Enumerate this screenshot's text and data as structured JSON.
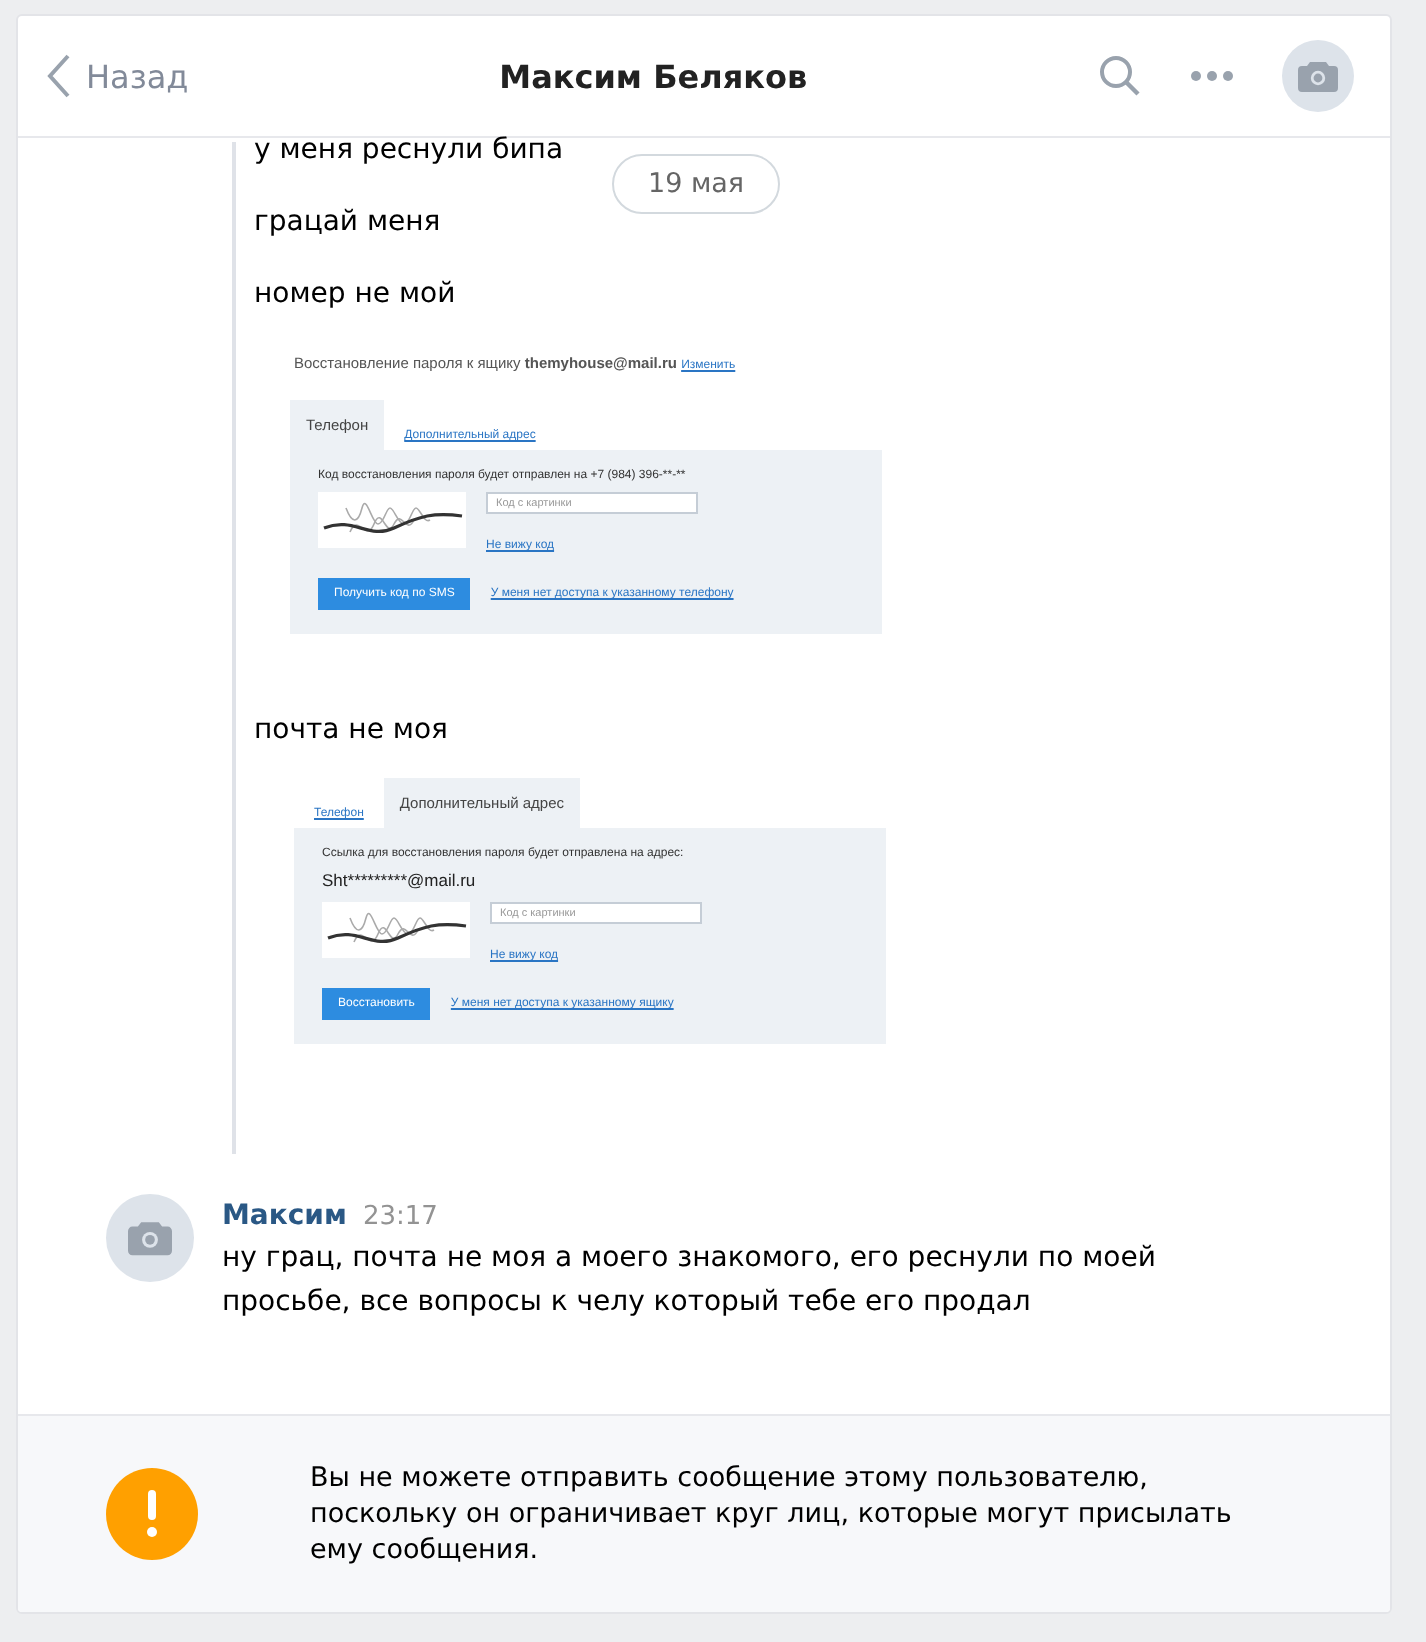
{
  "header": {
    "back_label": "Назад",
    "title": "Максим Беляков"
  },
  "date_pill": "19 мая",
  "forwarded": [
    {
      "kind": "text",
      "text": "у меня реснули бипа"
    },
    {
      "kind": "text",
      "text": "грацай меня"
    },
    {
      "kind": "text",
      "text": "номер не мой"
    },
    {
      "kind": "screenshot",
      "title": "Восстановление пароля к ящику **themyhouse@mail.ru**",
      "title_link": "Изменить",
      "tabs": [
        {
          "label": "Телефон",
          "selected": true
        },
        {
          "label": "Дополнительный адрес",
          "selected": false
        }
      ],
      "hint": "Код восстановления пароля будет отправлен на +7 (984) 396-**-**",
      "captcha_placeholder": "Код с картинки",
      "cant_see": "Не вижу код",
      "button": "Получить код по SMS",
      "no_access": "У меня нет доступа к указанному телефону"
    },
    {
      "kind": "text",
      "text": "почта не моя"
    },
    {
      "kind": "screenshot",
      "tabs": [
        {
          "label": "Телефон",
          "selected": false
        },
        {
          "label": "Дополнительный адрес",
          "selected": true
        }
      ],
      "hint": "Ссылка для восстановления пароля будет отправлена на адрес:",
      "address": "Sht*********@mail.ru",
      "captcha_placeholder": "Код с картинки",
      "cant_see": "Не вижу код",
      "button": "Восстановить",
      "no_access": "У меня нет доступа к указанному ящику"
    }
  ],
  "message": {
    "author": "Максим",
    "time": "23:17",
    "text": "ну грац, почта не моя а моего знакомого, его реснули по моей просьбе, все вопросы к челу который тебе его продал"
  },
  "notice": {
    "text": "Вы не можете отправить сообщение этому пользователю, поскольку он ограничивает круг лиц, которые могут присылать ему сообщения."
  }
}
